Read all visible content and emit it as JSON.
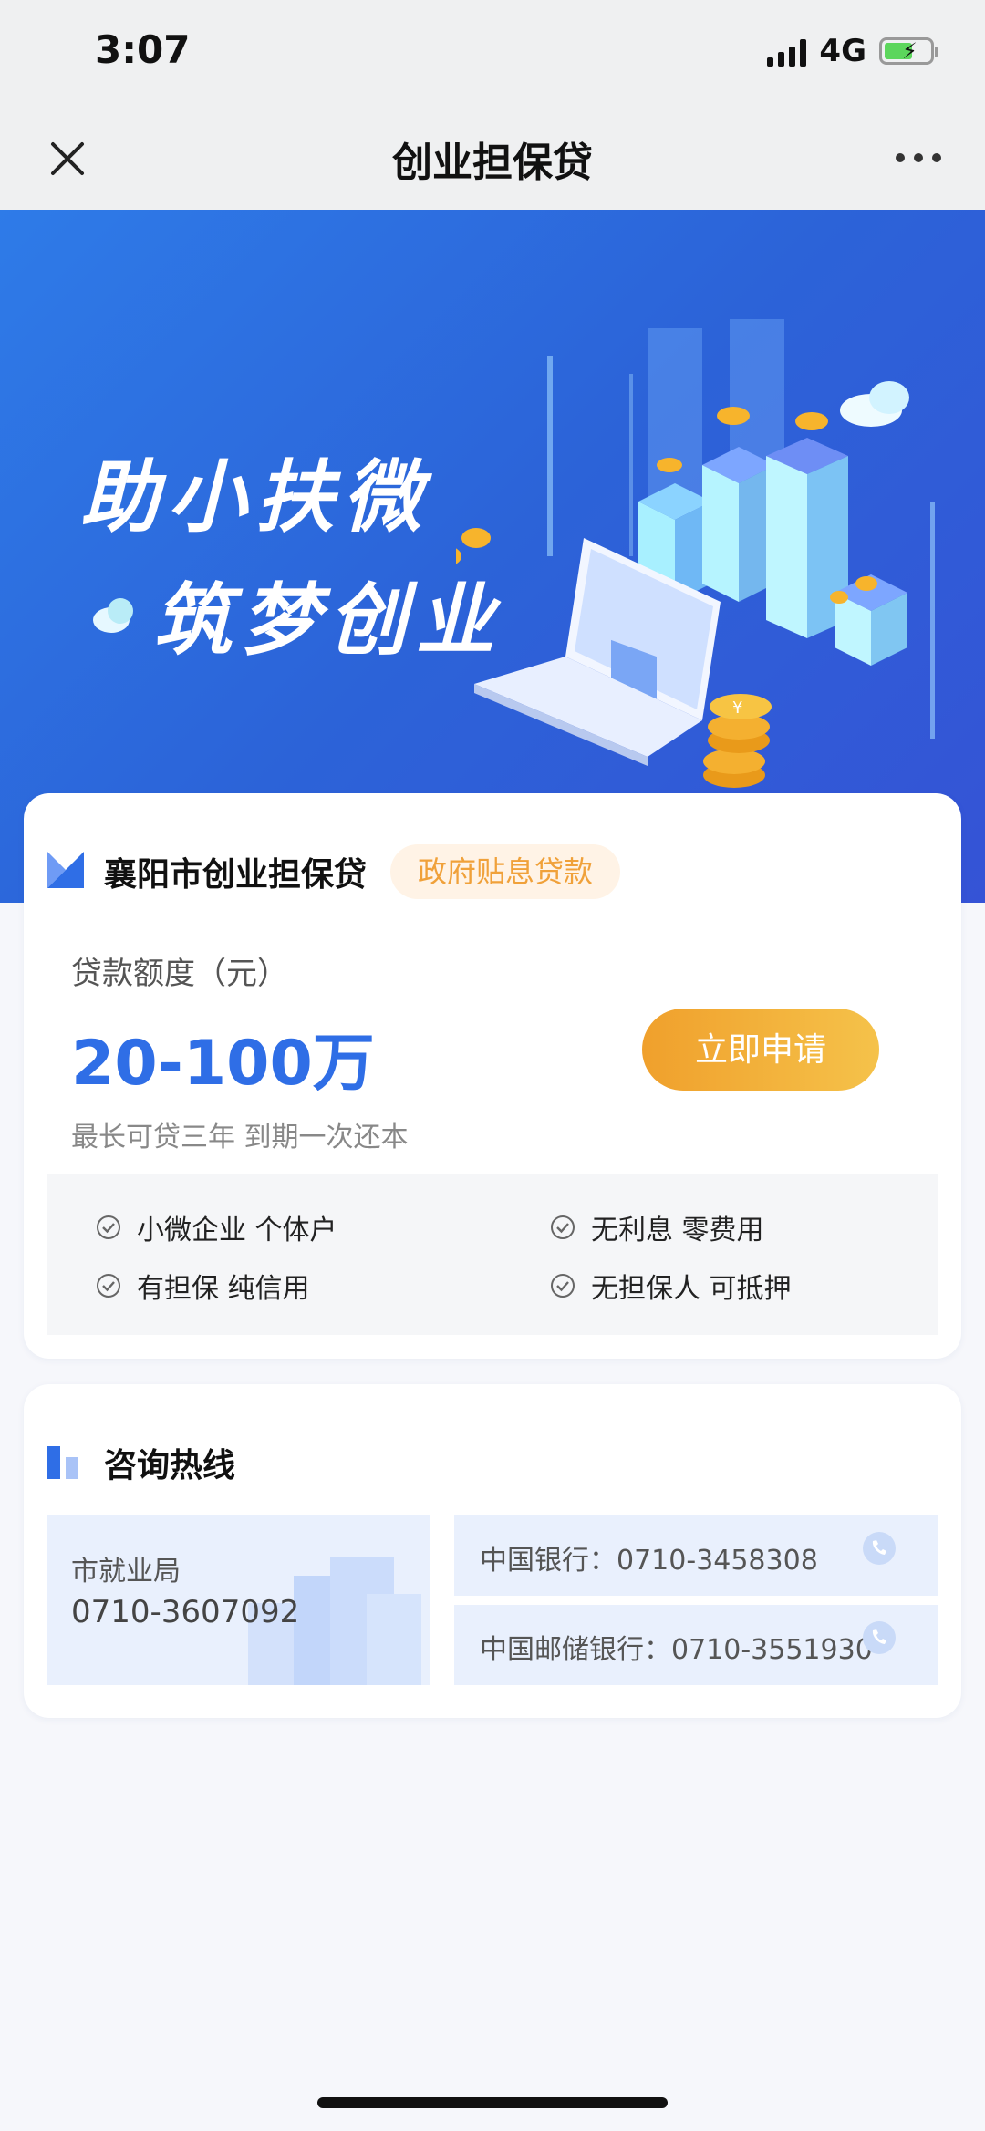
{
  "status_bar": {
    "time": "3:07",
    "network": "4G"
  },
  "nav": {
    "title": "创业担保贷"
  },
  "banner": {
    "line1": "助小扶微",
    "line2": "筑梦创业"
  },
  "loan": {
    "title": "襄阳市创业担保贷",
    "badge": "政府贴息贷款",
    "amount_label": "贷款额度（元）",
    "amount_value": "20-100万",
    "apply_label": "立即申请",
    "term_note": "最长可贷三年 到期一次还本",
    "features": [
      "小微企业 个体户",
      "无利息 零费用",
      "有担保 纯信用",
      "无担保人 可抵押"
    ]
  },
  "hotline": {
    "title": "咨询热线",
    "bureau_name": "市就业局",
    "bureau_phone": "0710-3607092",
    "banks": [
      "中国银行：0710-3458308",
      "中国邮储银行：0710-3551930"
    ]
  },
  "colors": {
    "primary": "#2f6ee6",
    "accent": "#f0a02c",
    "badge_text": "#f0a13a"
  },
  "icons": [
    "close-icon",
    "more-icon",
    "check-icon",
    "phone-icon",
    "brand-logo",
    "signal-icon",
    "battery-icon"
  ]
}
